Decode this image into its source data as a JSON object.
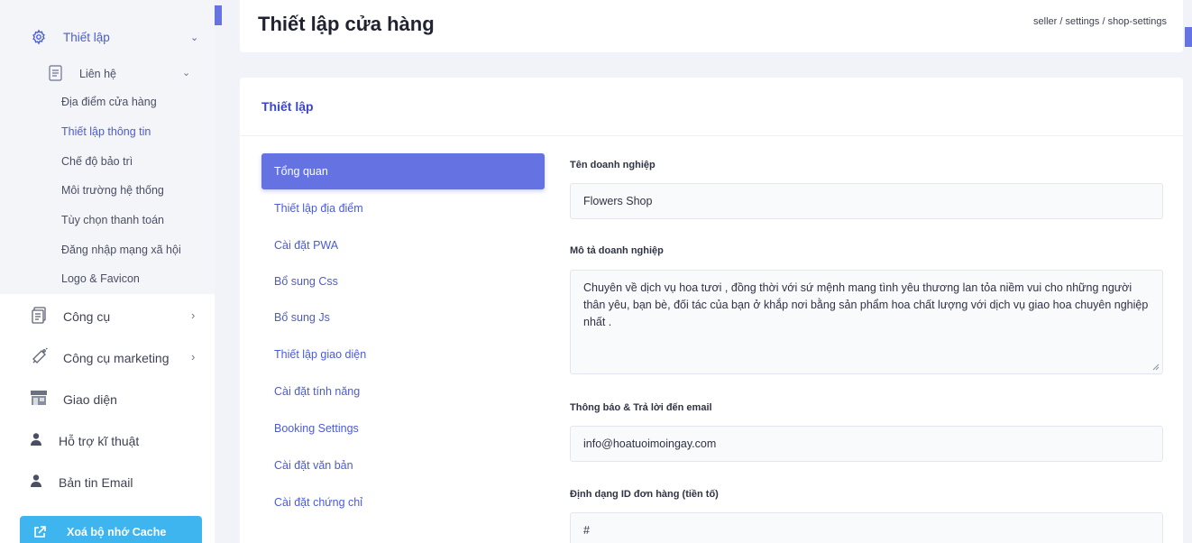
{
  "page": {
    "title": "Thiết lập cửa hàng",
    "breadcrumb": "seller  /  settings  /  shop-settings"
  },
  "sidebar": {
    "settings": {
      "label": "Thiết lập",
      "icon": "gear-icon"
    },
    "contact": {
      "label": "Liên hệ",
      "icon": "document-icon"
    },
    "sub_items": [
      {
        "label": "Địa điểm cửa hàng",
        "active": false
      },
      {
        "label": "Thiết lập thông tin",
        "active": true
      },
      {
        "label": "Chế độ bảo trì",
        "active": false
      },
      {
        "label": "Môi trường hệ thống",
        "active": false
      },
      {
        "label": "Tùy chọn thanh toán",
        "active": false
      },
      {
        "label": "Đăng nhập mạng xã hội",
        "active": false
      },
      {
        "label": "Logo & Favicon",
        "active": false
      }
    ],
    "tools": {
      "label": "Công cụ",
      "icon": "clipboard-icon"
    },
    "marketing": {
      "label": "Công cụ marketing",
      "icon": "megaphone-icon"
    },
    "interface": {
      "label": "Giao diện",
      "icon": "storefront-icon"
    },
    "support": {
      "label": "Hỗ trợ kĩ thuật",
      "icon": "user-icon"
    },
    "newsletter": {
      "label": "Bản tin Email",
      "icon": "user-icon"
    },
    "cache_button": {
      "label": "Xoá bộ nhớ Cache",
      "icon": "external-link-icon"
    }
  },
  "card": {
    "title": "Thiết lập",
    "tabs": [
      {
        "label": "Tổng quan",
        "active": true
      },
      {
        "label": "Thiết lập địa điểm",
        "active": false
      },
      {
        "label": "Cài đặt PWA",
        "active": false
      },
      {
        "label": "Bổ sung Css",
        "active": false
      },
      {
        "label": "Bổ sung Js",
        "active": false
      },
      {
        "label": "Thiết lập giao diện",
        "active": false
      },
      {
        "label": "Cài đặt tính năng",
        "active": false
      },
      {
        "label": "Booking Settings",
        "active": false
      },
      {
        "label": "Cài đặt văn bản",
        "active": false
      },
      {
        "label": "Cài đặt chứng chỉ",
        "active": false
      }
    ]
  },
  "form": {
    "business_name": {
      "label": "Tên doanh nghiệp",
      "value": "Flowers Shop"
    },
    "business_desc": {
      "label": "Mô tả doanh nghiệp",
      "value": "Chuyên về dịch vụ hoa tươi , đồng thời với sứ mệnh mang tình yêu thương lan tỏa niềm vui cho những người thân yêu, bạn bè, đối tác của bạn ở khắp nơi bằng sản phẩm hoa chất lượng với dịch vụ giao hoa chuyên nghiệp nhất ."
    },
    "notify_email": {
      "label": "Thông báo & Trả lời đến email",
      "value": "info@hoatuoimoingay.com"
    },
    "order_id_format": {
      "label": "Định dạng ID đơn hàng (tiền tố)",
      "value": "#"
    }
  },
  "colors": {
    "primary": "#6472e2",
    "link": "#4b5bd6",
    "cache_button": "#3fb5f0"
  }
}
